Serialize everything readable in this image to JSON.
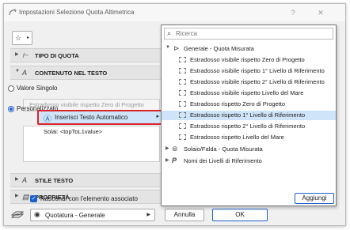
{
  "window": {
    "title": "Impostazioni Selezione Quota Altimetrica",
    "help_label": "?",
    "close_label": "✕"
  },
  "left_panel": {
    "favorites_icon": "star-icon",
    "sections": {
      "tipo_di_quota": "TIPO DI QUOTA",
      "contenuto_nel_testo": "CONTENUTO NEL TESTO",
      "stile_testo": "STILE TESTO",
      "proprieta": "PROPRIETÀ"
    },
    "radio_valore_singolo": "Valore Singolo",
    "valore_singolo_field": "Estradosso visibile rispetto Zero di Progetto",
    "radio_personalizzato": "Personalizzato",
    "insert_button_label": "Inserisci Testo Automatico",
    "custom_text": "Solai: <topToL1value>",
    "checkbox_label": "Nascondi con l'elemento associato",
    "layer_dropdown": "Quotatura - Generale",
    "cancel_label": "Annulla",
    "ok_label": "OK"
  },
  "popup": {
    "search_placeholder": "Ricerca",
    "group_1": "Generale - Quota Misurata",
    "items": [
      "Estradosso visibile rispetto Zero di Progetto",
      "Estradosso visibile rispetto 1° Livello di Riferimento",
      "Estradosso visibile rispetto 2° Livello di Riferimento",
      "Estradosso visibile rispetto Livello del Mare",
      "Estradosso rispetto Zero di Progetto",
      "Estradosso rispetto 1° Livello di Riferimento",
      "Estradosso rispetto 2° Livello di Riferimento",
      "Estradosso rispetto Livello del Mare"
    ],
    "selected_index": 5,
    "group_2": "Solaio/Falda - Quota Misurata",
    "group_3": "Nomi dei Livelli di Riferimento",
    "add_label": "Aggiungi"
  },
  "colors": {
    "accent": "#1d62c9",
    "selection": "#cfe4f8",
    "highlight_border": "#d9252a"
  }
}
